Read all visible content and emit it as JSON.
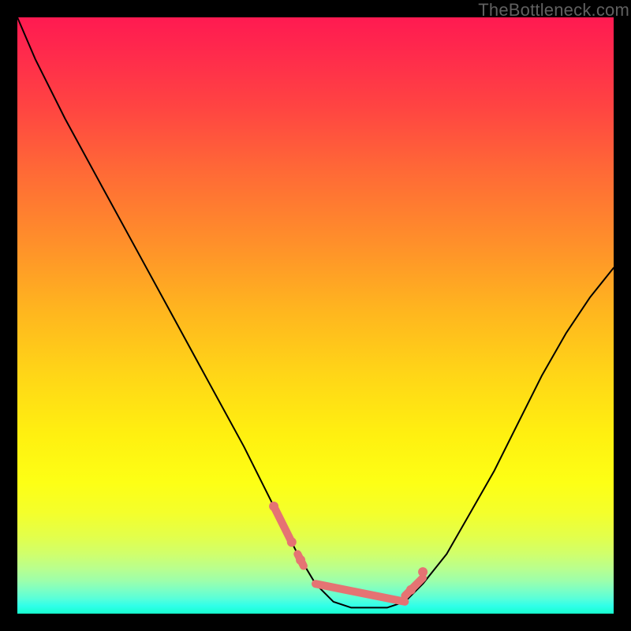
{
  "watermark": "TheBottleneck.com",
  "colors": {
    "highlight": "#e57373",
    "curve": "#000000"
  },
  "chart_data": {
    "type": "line",
    "title": "",
    "xlabel": "",
    "ylabel": "",
    "xlim": [
      0,
      100
    ],
    "ylim": [
      0,
      100
    ],
    "grid": false,
    "legend": false,
    "series": [
      {
        "name": "bottleneck-curve",
        "x": [
          0,
          3,
          8,
          14,
          20,
          26,
          32,
          38,
          43,
          47,
          50,
          53,
          56,
          59,
          62,
          65,
          68,
          72,
          76,
          80,
          84,
          88,
          92,
          96,
          100
        ],
        "y": [
          100,
          93,
          83,
          72,
          61,
          50,
          39,
          28,
          18,
          10,
          5,
          2,
          1,
          1,
          1,
          2,
          5,
          10,
          17,
          24,
          32,
          40,
          47,
          53,
          58
        ]
      }
    ],
    "highlight_segments": [
      {
        "x": [
          43,
          46
        ],
        "y": [
          18,
          12
        ]
      },
      {
        "x": [
          47,
          48
        ],
        "y": [
          10,
          8
        ]
      },
      {
        "x": [
          50,
          65
        ],
        "y": [
          5,
          2
        ]
      },
      {
        "x": [
          65,
          68
        ],
        "y": [
          3,
          6
        ]
      }
    ],
    "highlight_points": [
      {
        "x": 43,
        "y": 18
      },
      {
        "x": 46,
        "y": 12
      },
      {
        "x": 47.5,
        "y": 9
      },
      {
        "x": 66,
        "y": 4
      },
      {
        "x": 68,
        "y": 7
      }
    ]
  }
}
